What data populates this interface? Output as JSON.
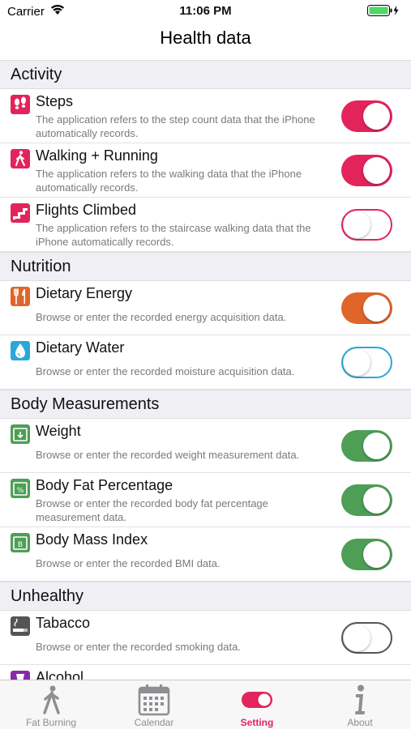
{
  "status": {
    "carrier": "Carrier",
    "time": "11:06 PM"
  },
  "nav": {
    "title": "Health data"
  },
  "sections": {
    "activity": {
      "header": "Activity",
      "steps": {
        "title": "Steps",
        "desc": "The application refers to the step count data that the iPhone automatically records.",
        "enabled": true
      },
      "walking": {
        "title": "Walking + Running",
        "desc": "The application refers to the walking data that the iPhone automatically records.",
        "enabled": true
      },
      "flights": {
        "title": "Flights Climbed",
        "desc": "The application refers to the staircase walking data that the iPhone automatically records.",
        "enabled": false
      }
    },
    "nutrition": {
      "header": "Nutrition",
      "energy": {
        "title": "Dietary Energy",
        "desc": "Browse or enter the recorded energy acquisition data.",
        "enabled": true
      },
      "water": {
        "title": "Dietary Water",
        "desc": "Browse or enter the recorded moisture acquisition data.",
        "enabled": false
      }
    },
    "body": {
      "header": "Body Measurements",
      "weight": {
        "title": "Weight",
        "desc": "Browse or enter the recorded weight measurement data.",
        "enabled": true
      },
      "fat": {
        "title": "Body Fat Percentage",
        "desc": "Browse or enter the recorded body fat percentage measurement data.",
        "enabled": true
      },
      "bmi": {
        "title": "Body Mass Index",
        "desc": "Browse or enter the recorded BMI data.",
        "enabled": true
      }
    },
    "unhealthy": {
      "header": "Unhealthy",
      "tabacco": {
        "title": "Tabacco",
        "desc": "Browse or enter the recorded smoking data.",
        "enabled": false
      },
      "alcohol": {
        "title": "Alcohol"
      }
    }
  },
  "tabs": [
    {
      "label": "Fat Burning",
      "icon": "walking-person-icon"
    },
    {
      "label": "Calendar",
      "icon": "calendar-icon"
    },
    {
      "label": "Setting",
      "icon": "toggle-icon",
      "active": true
    },
    {
      "label": "About",
      "icon": "info-icon"
    }
  ],
  "colors": {
    "activity": "#e3245c",
    "nutrition_energy": "#e0652a",
    "nutrition_water": "#2aa8d8",
    "body": "#4e9e56",
    "unhealthy": "#555555",
    "alcohol": "#8a2aa8",
    "tab_active": "#e3245c",
    "tab_inactive": "#8e8e93"
  }
}
